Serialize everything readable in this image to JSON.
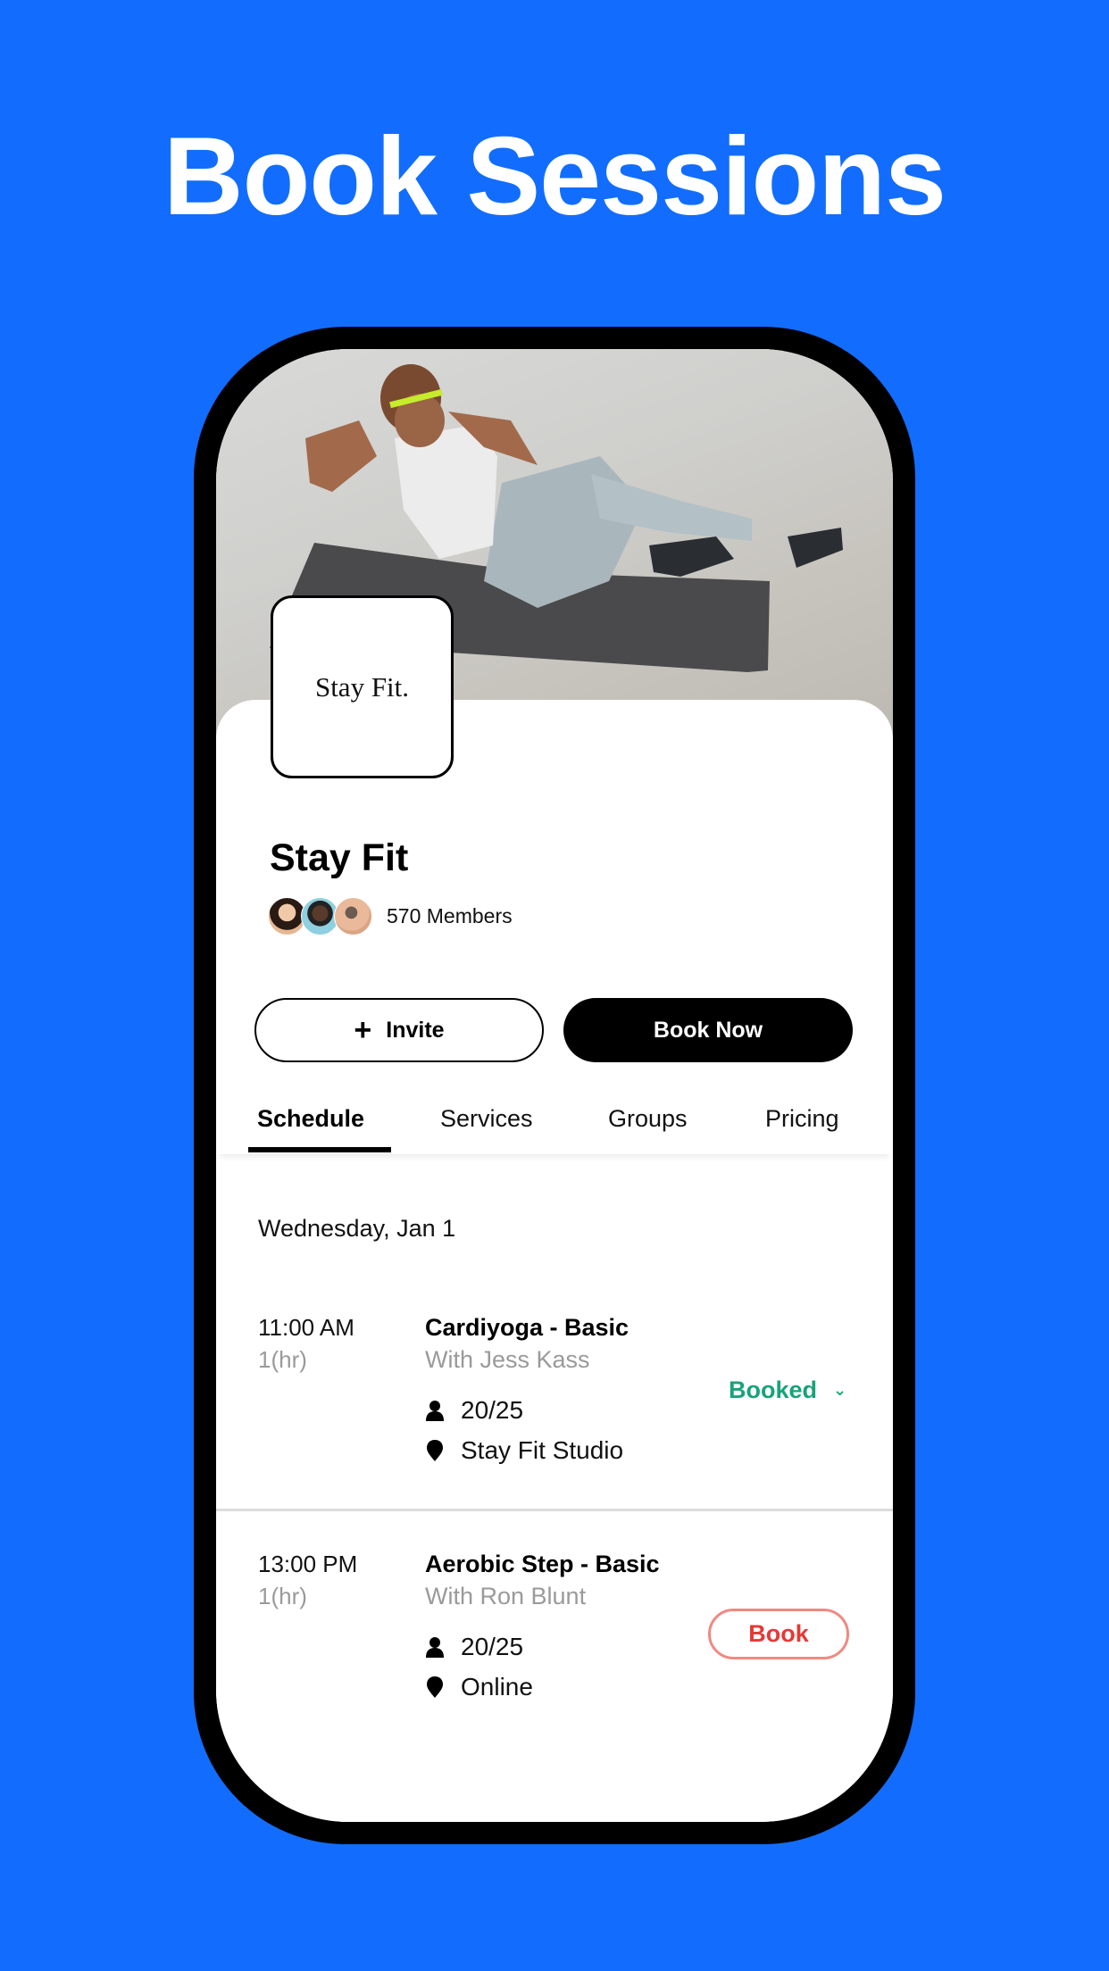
{
  "headline": "Book Sessions",
  "colors": {
    "background": "#126dff",
    "booked_green": "#18a37a",
    "book_red": "#e53935",
    "book_border": "#ef8a82"
  },
  "group": {
    "logo_text": "Stay Fit.",
    "name": "Stay Fit",
    "members_label": "570 Members",
    "avatars": [
      "member-avatar-1",
      "member-avatar-2",
      "member-avatar-3"
    ]
  },
  "actions": {
    "invite_icon": "plus-icon",
    "invite_label": "Invite",
    "book_now_label": "Book Now"
  },
  "tabs": [
    {
      "label": "Schedule",
      "active": true
    },
    {
      "label": "Services",
      "active": false
    },
    {
      "label": "Groups",
      "active": false
    },
    {
      "label": "Pricing",
      "active": false
    }
  ],
  "schedule": {
    "date": "Wednesday, Jan 1",
    "sessions": [
      {
        "time": "11:00 AM",
        "duration": "1(hr)",
        "title": "Cardiyoga - Basic",
        "instructor": "With Jess Kass",
        "capacity": "20/25",
        "location": "Stay Fit Studio",
        "status": "Booked",
        "status_icon": "chevron-down-icon"
      },
      {
        "time": "13:00 PM",
        "duration": "1(hr)",
        "title": "Aerobic Step - Basic",
        "instructor": "With Ron Blunt",
        "capacity": "20/25",
        "location": "Online",
        "action": "Book"
      }
    ]
  }
}
